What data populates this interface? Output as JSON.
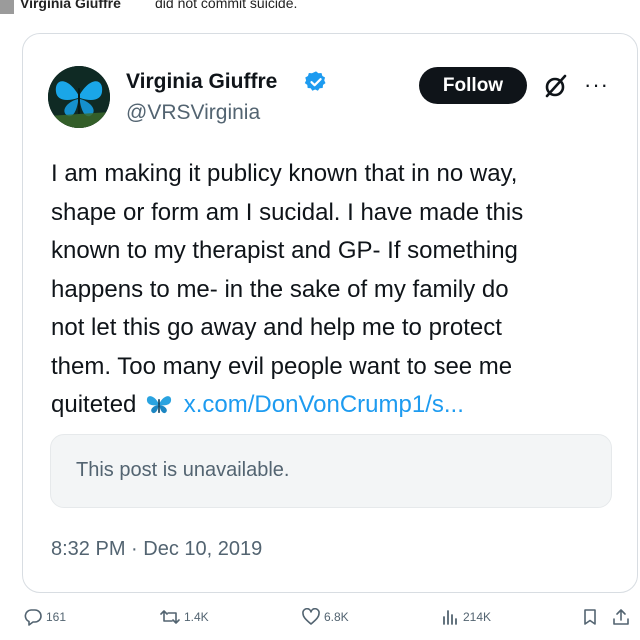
{
  "top_caption": {
    "name": "Virginia Giuffre",
    "rest": "did not commit suicide."
  },
  "tweet": {
    "display_name": "Virginia Giuffre",
    "handle": "@VRSVirginia",
    "follow_label": "Follow",
    "more_label": "···",
    "text_lines": [
      "I am making it publicy known that in no way,",
      "shape or form am I sucidal. I have made this",
      "known to my therapist and GP- If something",
      "happens to me- in the sake of my family do",
      "not let this go away and help me to protect",
      "them. Too many evil people want to see me"
    ],
    "last_line_prefix": "quiteted",
    "link_text": "x.com/DonVonCrump1/s...",
    "quoted_post": "This post is unavailable.",
    "timestamp": "8:32 PM · Dec 10, 2019"
  },
  "actions": {
    "replies": "161",
    "reposts": "1.4K",
    "likes": "6.8K",
    "views": "214K"
  },
  "colors": {
    "accent": "#1d9bf0",
    "text_primary": "#0f1419",
    "text_secondary": "#536471",
    "follow_bg": "#0f1419",
    "butterfly": "#2aa3e0"
  },
  "icons": {
    "verified": "verified-badge-icon",
    "grok": "grok-icon",
    "more": "more-options-icon",
    "reply": "reply-icon",
    "repost": "repost-icon",
    "like": "heart-icon",
    "views": "views-icon",
    "bookmark": "bookmark-icon",
    "share": "share-icon"
  }
}
